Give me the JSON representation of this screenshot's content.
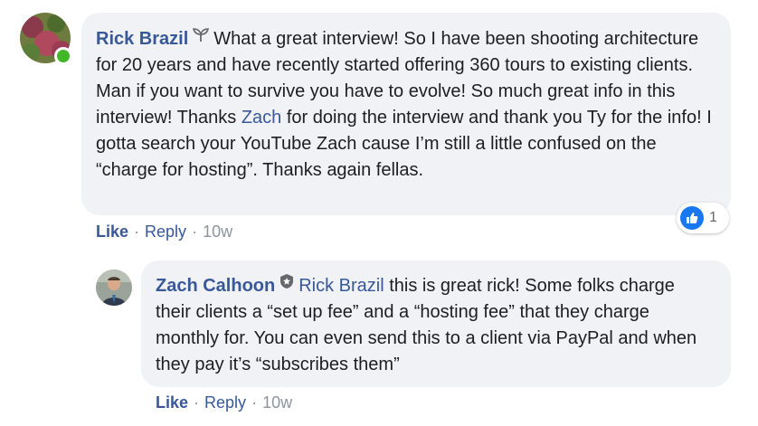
{
  "comment": {
    "author": "Rick Brazil",
    "author_badge_icon": "sprout-icon",
    "text_before_mention": "What a great interview! So I have been shooting architecture for 20 years and have recently started offering 360 tours to existing clients. Man if you want to survive you have to evolve! So much great info in this interview! Thanks ",
    "mention": "Zach",
    "text_after_mention": " for doing the interview and thank you Ty for the info! I gotta search your YouTube Zach cause I’m still a little confused on the “charge for hosting”. Thanks again fellas.",
    "actions": {
      "like": "Like",
      "reply": "Reply",
      "time": "10w"
    },
    "reactions": {
      "icon": "thumbs-up-icon",
      "count": "1"
    },
    "online": true
  },
  "reply": {
    "author": "Zach Calhoon",
    "author_badge_icon": "shield-star-icon",
    "mention": "Rick Brazil",
    "text": " this is great rick! Some folks charge their clients a “set up fee” and a “hosting fee” that they charge monthly for. You can even send this to a client via PayPal and when they pay it’s “subscribes them”",
    "actions": {
      "like": "Like",
      "reply": "Reply",
      "time": "10w"
    }
  },
  "colors": {
    "link": "#385898",
    "bubble_bg": "#f0f2f5",
    "meta": "#8d949e",
    "online": "#42b72a",
    "reaction_like": "#1877f2"
  }
}
